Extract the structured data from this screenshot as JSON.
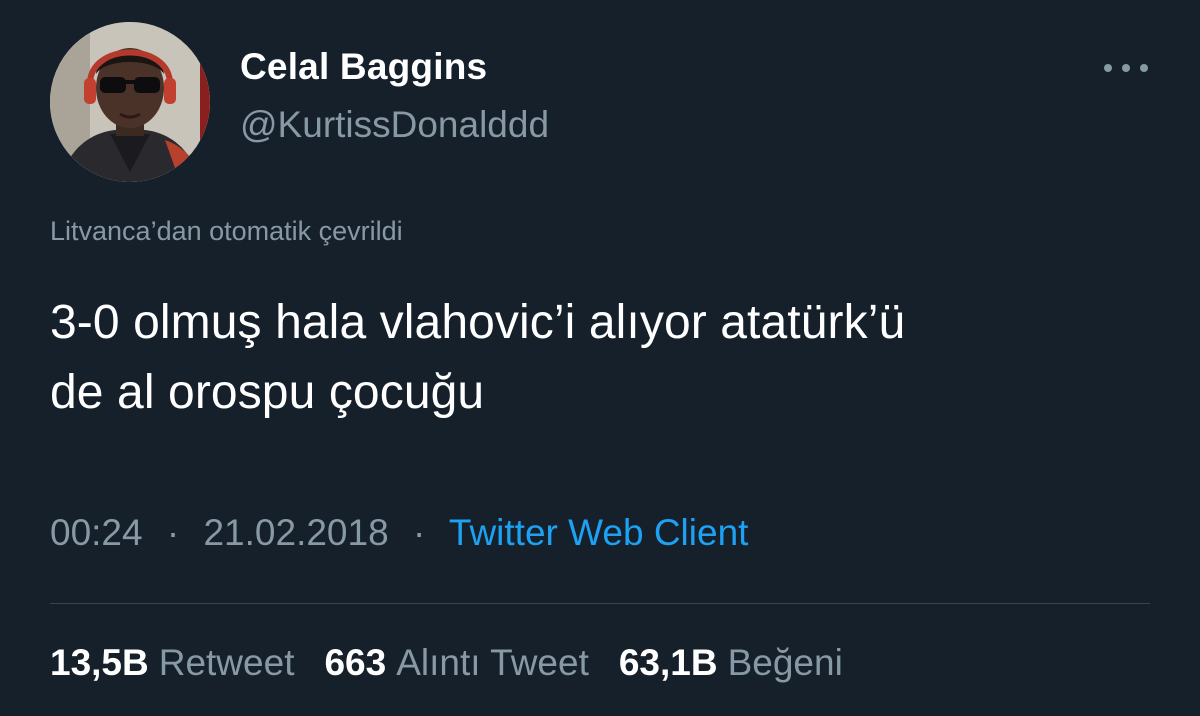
{
  "author": {
    "display_name": "Celal Baggins",
    "handle": "@KurtissDonalddd"
  },
  "more_icon": "more-horizontal-icon",
  "translation_notice": "Litvanca’dan otomatik çevrildi",
  "tweet": {
    "lines": [
      "3-0 olmuş hala vlahovic’i alıyor atatürk’ü",
      "de al orospu çocuğu"
    ]
  },
  "meta": {
    "time": "00:24",
    "separator": "·",
    "date": "21.02.2018",
    "source": "Twitter Web Client"
  },
  "stats": [
    {
      "count": "13,5B",
      "label": "Retweet"
    },
    {
      "count": "663",
      "label": "Alıntı Tweet"
    },
    {
      "count": "63,1B",
      "label": "Beğeni"
    }
  ],
  "colors": {
    "background": "#15202b",
    "primary_text": "#ffffff",
    "secondary_text": "#8899a6",
    "link": "#1da1f2",
    "divider": "#38444d"
  }
}
